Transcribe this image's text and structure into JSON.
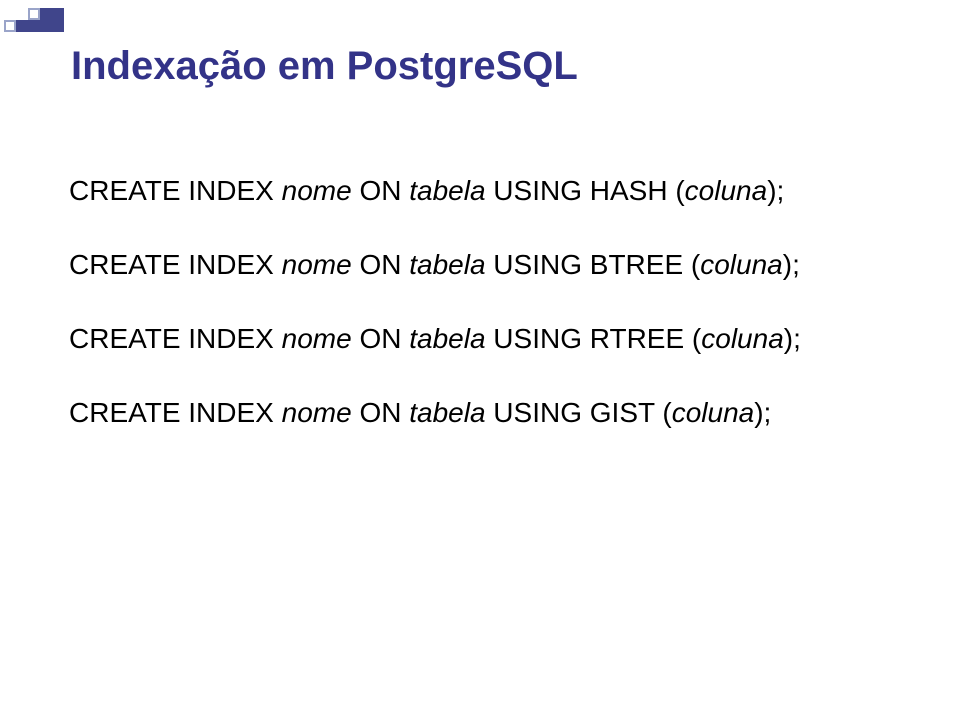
{
  "title": "Indexação em PostgreSQL",
  "statements": [
    {
      "prefix": "CREATE INDEX ",
      "var1": "nome",
      "mid1": " ON ",
      "var2": "tabela",
      "mid2": " USING HASH (",
      "var3": "coluna",
      "suffix": ");"
    },
    {
      "prefix": "CREATE INDEX ",
      "var1": "nome",
      "mid1": " ON ",
      "var2": "tabela",
      "mid2": " USING BTREE (",
      "var3": "coluna",
      "suffix": ");"
    },
    {
      "prefix": "CREATE INDEX ",
      "var1": "nome",
      "mid1": " ON ",
      "var2": "tabela",
      "mid2": " USING RTREE (",
      "var3": "coluna",
      "suffix": ");"
    },
    {
      "prefix": "CREATE INDEX ",
      "var1": "nome",
      "mid1": " ON ",
      "var2": "tabela",
      "mid2": " USING GIST (",
      "var3": "coluna",
      "suffix": ");"
    }
  ],
  "colors": {
    "accent": "#333388",
    "deco_fill": "#40458b",
    "deco_outline": "#9aa4c9"
  }
}
